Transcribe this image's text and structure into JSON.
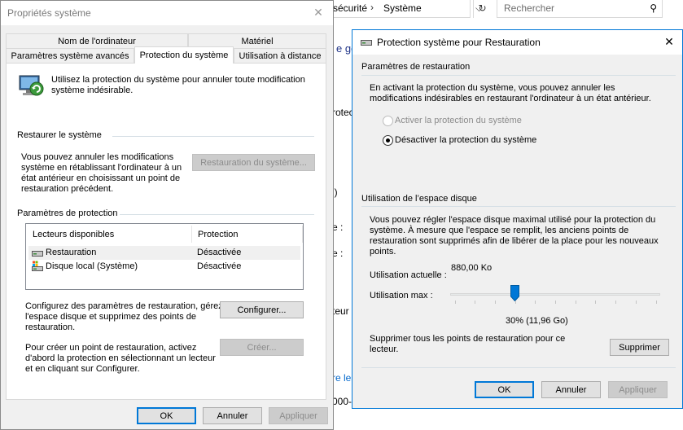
{
  "explorer": {
    "breadcrumb_part": "sécurité",
    "breadcrumb_current": "Système",
    "search_placeholder": "Rechercher",
    "fragments": [
      "e gé",
      "rotec",
      "l)",
      "e :",
      "e :",
      "teur :",
      "re les",
      "000-"
    ]
  },
  "sysprops": {
    "title": "Propriétés système",
    "tabs_row1": [
      "Nom de l'ordinateur",
      "Matériel"
    ],
    "tabs_row2": [
      "Paramètres système avancés",
      "Protection du système",
      "Utilisation à distance"
    ],
    "intro": [
      "Utilisez la protection du système pour annuler toute modification",
      "système indésirable."
    ],
    "restore_group": "Restaurer le système",
    "restore_text": [
      "Vous pouvez annuler les modifications",
      "système en rétablissant l'ordinateur à un",
      "état antérieur en choisissant un point de",
      "restauration précédent."
    ],
    "restore_button": "Restauration du système...",
    "protection_group": "Paramètres de protection",
    "drives_header": [
      "Lecteurs disponibles",
      "Protection"
    ],
    "drives": [
      {
        "name": "Restauration",
        "status": "Désactivée"
      },
      {
        "name": "Disque local (Système)",
        "status": "Désactivée"
      }
    ],
    "configure_text": [
      "Configurez des paramètres de restauration, gérez",
      "l'espace disque et supprimez des points de",
      "restauration."
    ],
    "configure_button": "Configurer...",
    "create_text": [
      "Pour créer un point de restauration, activez",
      "d'abord la protection en sélectionnant un lecteur",
      "et en cliquant sur Configurer."
    ],
    "create_button": "Créer...",
    "ok": "OK",
    "cancel": "Annuler",
    "apply": "Appliquer"
  },
  "protect": {
    "title": "Protection système pour Restauration",
    "restore_group": "Paramètres de restauration",
    "restore_text": [
      "En activant la protection du système, vous pouvez annuler les",
      "modifications indésirables en restaurant l'ordinateur à un état antérieur."
    ],
    "radio_enable": "Activer la protection du système",
    "radio_disable": "Désactiver la protection du système",
    "disk_group": "Utilisation de l’espace disque",
    "disk_text": [
      "Vous pouvez régler l'espace disque maximal utilisé pour la protection du",
      "système. À mesure que l'espace se remplit, les anciens points de",
      "restauration sont supprimés afin de libérer de la place pour les nouveaux",
      "points."
    ],
    "current_label": "Utilisation actuelle :",
    "current_value": "880,00 Ko",
    "max_label": "Utilisation max :",
    "slider_percent": 30,
    "slider_value_text": "30% (11,96 Go)",
    "delete_text": [
      "Supprimer tous les points de restauration pour ce",
      "lecteur."
    ],
    "delete_button": "Supprimer",
    "ok": "OK",
    "cancel": "Annuler",
    "apply": "Appliquer"
  }
}
